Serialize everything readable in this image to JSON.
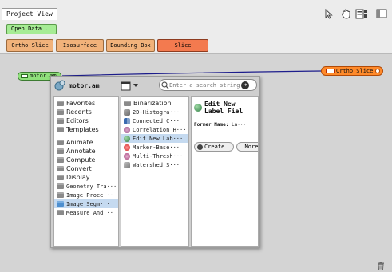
{
  "app": {
    "view_tab": "Project View",
    "toolbar_icons": [
      "cursor-icon",
      "hand-icon",
      "layout-icon",
      "panel-icon"
    ]
  },
  "buttons": {
    "open_data": "Open Data...",
    "ortho_slice": "Ortho Slice",
    "isosurface": "Isosurface",
    "bounding_box": "Bounding Box",
    "slice": "Slice"
  },
  "pool": {
    "data_node": "motor.am",
    "module_node": "Ortho Slice"
  },
  "popup": {
    "breadcrumb": "motor.am",
    "search_placeholder": "Enter a search string",
    "categories": [
      {
        "label": "Favorites",
        "kind": "sans"
      },
      {
        "label": "Recents",
        "kind": "sans"
      },
      {
        "label": "Editors",
        "kind": "sans"
      },
      {
        "label": "Templates",
        "kind": "sans"
      },
      {
        "label": "Animate",
        "kind": "sans"
      },
      {
        "label": "Annotate",
        "kind": "sans"
      },
      {
        "label": "Compute",
        "kind": "sans"
      },
      {
        "label": "Convert",
        "kind": "sans"
      },
      {
        "label": "Display",
        "kind": "sans"
      },
      {
        "label": "Geometry Tra···",
        "kind": "mono"
      },
      {
        "label": "Image Proce···",
        "kind": "mono"
      },
      {
        "label": "Image Segm···",
        "kind": "mono"
      },
      {
        "label": "Measure And···",
        "kind": "mono"
      }
    ],
    "modules": [
      {
        "label": "Binarization"
      },
      {
        "label": "2D-Histogra···"
      },
      {
        "label": "Connected C···"
      },
      {
        "label": "Correlation H···"
      },
      {
        "label": "Edit New Lab···"
      },
      {
        "label": "Marker-Base···"
      },
      {
        "label": "Multi-Thresh···"
      },
      {
        "label": "Watershed S···"
      }
    ],
    "detail": {
      "title_line1": "Edit New",
      "title_line2": "Label Fiel",
      "former_name_label": "Former Name:",
      "former_name_value": "La···",
      "create_label": "Create",
      "more_label": "More"
    }
  },
  "colors": {
    "data_green": "#8fe07b",
    "module_orange": "#f1b27a",
    "slice_orange": "#f37a4f",
    "ortho_node": "#ff8a2a",
    "selection": "#c5daf0"
  }
}
